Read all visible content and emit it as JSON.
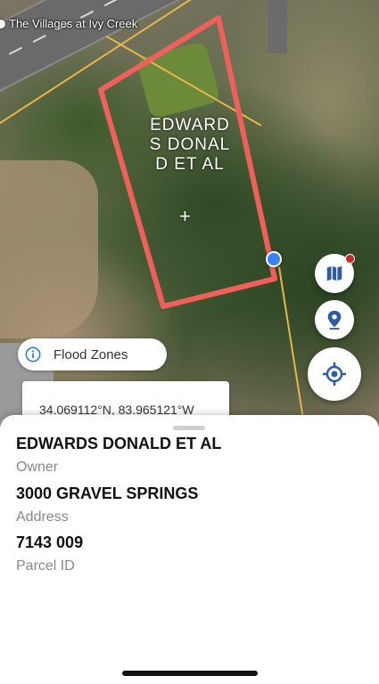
{
  "map": {
    "place_label": "The Villages at Ivy Creek",
    "parcel_label": "EDWARDS DONALD ET AL",
    "crosshair": "+",
    "coordinates": "34.069112°N, 83.965121°W",
    "flood_chip_label": "Flood Zones",
    "parcel_outline_color": "#f0605a",
    "location_dot_color": "#3b82f6",
    "buttons": {
      "map_layers_icon": "map-icon",
      "pin_icon": "location-pin-icon",
      "my_location_icon": "my-location-icon"
    }
  },
  "sheet": {
    "owner": {
      "value": "EDWARDS DONALD ET AL",
      "label": "Owner"
    },
    "address": {
      "value": "3000 GRAVEL SPRINGS",
      "label": "Address"
    },
    "parcel": {
      "value": "7143 009",
      "label": "Parcel ID"
    }
  }
}
